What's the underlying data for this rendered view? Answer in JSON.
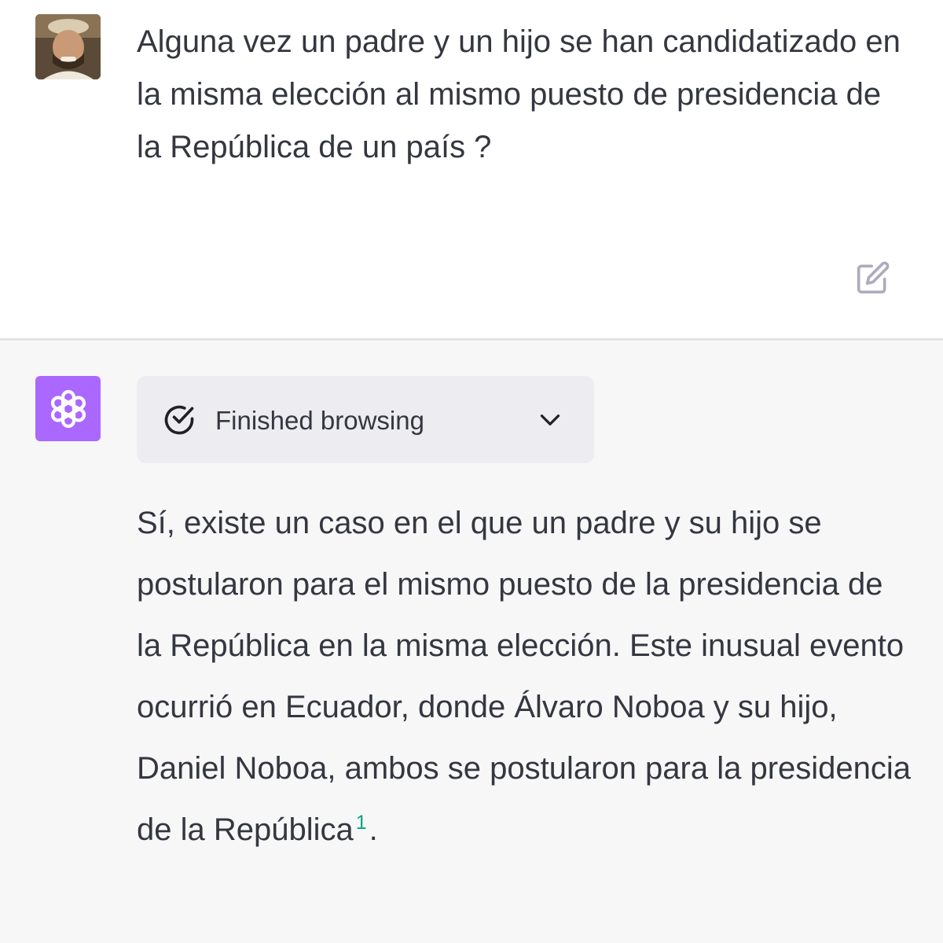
{
  "conversation": {
    "user_message": {
      "text": "Alguna vez un padre y un hijo se han candidatizado en la misma elección al mismo puesto de presidencia de la República de un país ?",
      "avatar_icon": "user-photo-avatar",
      "edit_icon": "pencil-square-icon"
    },
    "assistant_message": {
      "avatar_icon": "openai-logo-icon",
      "avatar_color": "#ab68ff",
      "browsing": {
        "status_label": "Finished browsing",
        "status_icon": "check-circle-icon",
        "toggle_icon": "chevron-down-icon"
      },
      "answer_text": "Sí, existe un caso en el que un padre y su hijo se postularon para el mismo puesto de la presidencia de la República en la misma elección. Este inusual evento ocurrió en Ecuador, donde Álvaro Noboa y su hijo, Daniel Noboa, ambos se postularon para la presidencia de la República",
      "citation": "1",
      "answer_end": "."
    }
  },
  "colors": {
    "text": "#353740",
    "citation": "#10a37f",
    "assistant_background": "#f7f7f8",
    "browse_panel": "#ececf1"
  }
}
